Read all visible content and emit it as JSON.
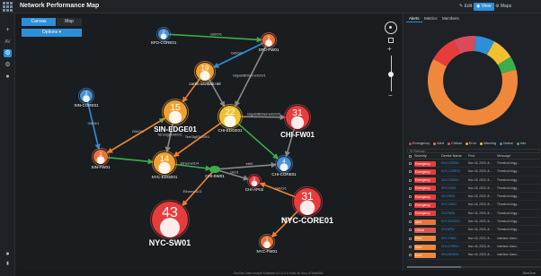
{
  "app": {
    "title": "Network Performance Map",
    "edit": "Edit",
    "view": "View",
    "maps": "Maps"
  },
  "sidebar": {
    "home": "AV"
  },
  "view_tabs": {
    "canvas": "Canvas",
    "map": "Map"
  },
  "options": "Options ▾",
  "nodes": [
    {
      "id": "sfo-core",
      "label": "SFO-CORE01",
      "badge": "3",
      "color": "#4a90d9"
    },
    {
      "id": "sfo-fw",
      "label": "SFO-FW01",
      "badge": "1",
      "color": "#e8743c"
    },
    {
      "id": "core0",
      "label": "core0.savitlab.net",
      "badge": "19",
      "color": "#f0a030"
    },
    {
      "id": "sin-core",
      "label": "SIN-CORE01",
      "badge": "2",
      "color": "#4a90d9"
    },
    {
      "id": "sin-edge",
      "label": "SIN-EDGE01",
      "badge": "15",
      "color": "#f0a030"
    },
    {
      "id": "chi-edge",
      "label": "CHI-EDGE01",
      "badge": "22",
      "color": "#f0c030"
    },
    {
      "id": "chi-fw",
      "label": "CHI-FW01",
      "badge": "31",
      "color": "#e83c3c"
    },
    {
      "id": "sin-fw",
      "label": "SIN-FW01",
      "badge": "1",
      "color": "#e8743c"
    },
    {
      "id": "nyc-edge",
      "label": "NYC-EDGE01",
      "badge": "14",
      "color": "#f0a030"
    },
    {
      "id": "chi-core",
      "label": "CHI-CORE01",
      "badge": "4",
      "color": "#4a90d9"
    },
    {
      "id": "chi-sw",
      "label": "CHI-SW01",
      "badge": "",
      "color": "#3cae4c"
    },
    {
      "id": "chi-ap",
      "label": "CHI-AP02",
      "badge": "2",
      "color": "#e83c3c"
    },
    {
      "id": "nyc-core",
      "label": "NYC-CORE01",
      "badge": "31",
      "color": "#e83c3c"
    },
    {
      "id": "nyc-sw",
      "label": "NYC-SW01",
      "badge": "43",
      "color": "#e83c3c"
    },
    {
      "id": "nyc-fw",
      "label": "NYC-FW01",
      "badge": "1",
      "color": "#e8743c"
    }
  ],
  "edge_labels": [
    "Gi0/0/1",
    "Gi0/0/1",
    "GigabitEthernet1/0/1",
    "GigabitEthernet1/1/0/0",
    "Gi0/0/1",
    "Gi0/0/0",
    "GigabitEthernet1/0/0",
    "TenGigE0/0/0/1",
    "TenGigE0/0/0/1",
    "Ethernet1/4",
    "eth0",
    "Gi0/1",
    "Ethernet1/3",
    "Gi0/0/1",
    "Gi0/0/1"
  ],
  "right": {
    "tabs": [
      "Alerts",
      "Metrics",
      "Members"
    ],
    "legend": [
      {
        "name": "Emergency",
        "color": "#e83c3c"
      },
      {
        "name": "Alert",
        "color": "#e8743c"
      },
      {
        "name": "Critical",
        "color": "#d9534f"
      },
      {
        "name": "Error",
        "color": "#f0a030"
      },
      {
        "name": "Warning",
        "color": "#f0c030"
      },
      {
        "name": "Notice",
        "color": "#2d8fd8"
      },
      {
        "name": "Info",
        "color": "#3cae4c"
      }
    ],
    "donut": [
      {
        "name": "Error",
        "value": 62,
        "color": "#f0883c"
      },
      {
        "name": "Emergency",
        "value": 10,
        "color": "#e83c3c"
      },
      {
        "name": "Alert",
        "value": 8,
        "color": "#d94a5a"
      },
      {
        "name": "Notice",
        "value": 7,
        "color": "#2d8fd8"
      },
      {
        "name": "Warning",
        "value": 8,
        "color": "#f0c030"
      },
      {
        "name": "Info",
        "value": 5,
        "color": "#3cae4c"
      }
    ],
    "filter_placeholder": "Refresh",
    "headers": [
      "",
      "Severity",
      "Device Name",
      "First",
      "Message"
    ],
    "rows": [
      {
        "sev": "Emergency",
        "color": "#e83c3c",
        "device": "SIN-CORE01",
        "first": "Nov 18, 2023, 8:...",
        "msg": "Threshold trigg..."
      },
      {
        "sev": "Emergency",
        "color": "#e83c3c",
        "device": "NYC-CORE01",
        "first": "Nov 18, 2023, 8:...",
        "msg": "Threshold trigg..."
      },
      {
        "sev": "Emergency",
        "color": "#e83c3c",
        "device": "SIN-CORE01",
        "first": "Nov 18, 2023, 8:...",
        "msg": "Threshold trigg..."
      },
      {
        "sev": "Emergency",
        "color": "#e83c3c",
        "device": "SFO-FW01",
        "first": "Nov 18, 2023, 8:...",
        "msg": "Threshold trigg..."
      },
      {
        "sev": "Emergency",
        "color": "#e83c3c",
        "device": "SIN-FW01",
        "first": "Nov 18, 2023, 8:...",
        "msg": "Threshold trigg..."
      },
      {
        "sev": "Emergency",
        "color": "#e83c3c",
        "device": "NYC-SW01",
        "first": "Nov 18, 2023, 8:...",
        "msg": "Threshold trigg..."
      },
      {
        "sev": "Emergency",
        "color": "#e83c3c",
        "device": "CHI-FW01",
        "first": "Nov 18, 2023, 8:...",
        "msg": "Threshold trigg..."
      },
      {
        "sev": "Alert",
        "color": "#e8743c",
        "device": "NYC-EDGE01",
        "first": "Nov 18, 2023, 8:...",
        "msg": "Threshold trigg..."
      },
      {
        "sev": "Critical",
        "color": "#d9534f",
        "device": "CHI-AP02",
        "first": "Nov 18, 2023, 8:...",
        "msg": "Threshold trigg..."
      },
      {
        "sev": "Error",
        "color": "#f0883c",
        "device": "NYC-FW01",
        "first": "Nov 18, 2023, 8:...",
        "msg": "Interface down..."
      },
      {
        "sev": "Error",
        "color": "#f0883c",
        "device": "CHI-CORE01",
        "first": "Nov 18, 2023, 8:...",
        "msg": "Interface down..."
      },
      {
        "sev": "Error",
        "color": "#f0883c",
        "device": "SIN-EDGE01",
        "first": "Nov 18, 2023, 8:...",
        "msg": "Interface down..."
      }
    ]
  },
  "footer": {
    "text": "ZenOss Data Insight Software (v1.0.2.0 build 46 dnx) a75a663f4",
    "brand": "SimOne"
  }
}
